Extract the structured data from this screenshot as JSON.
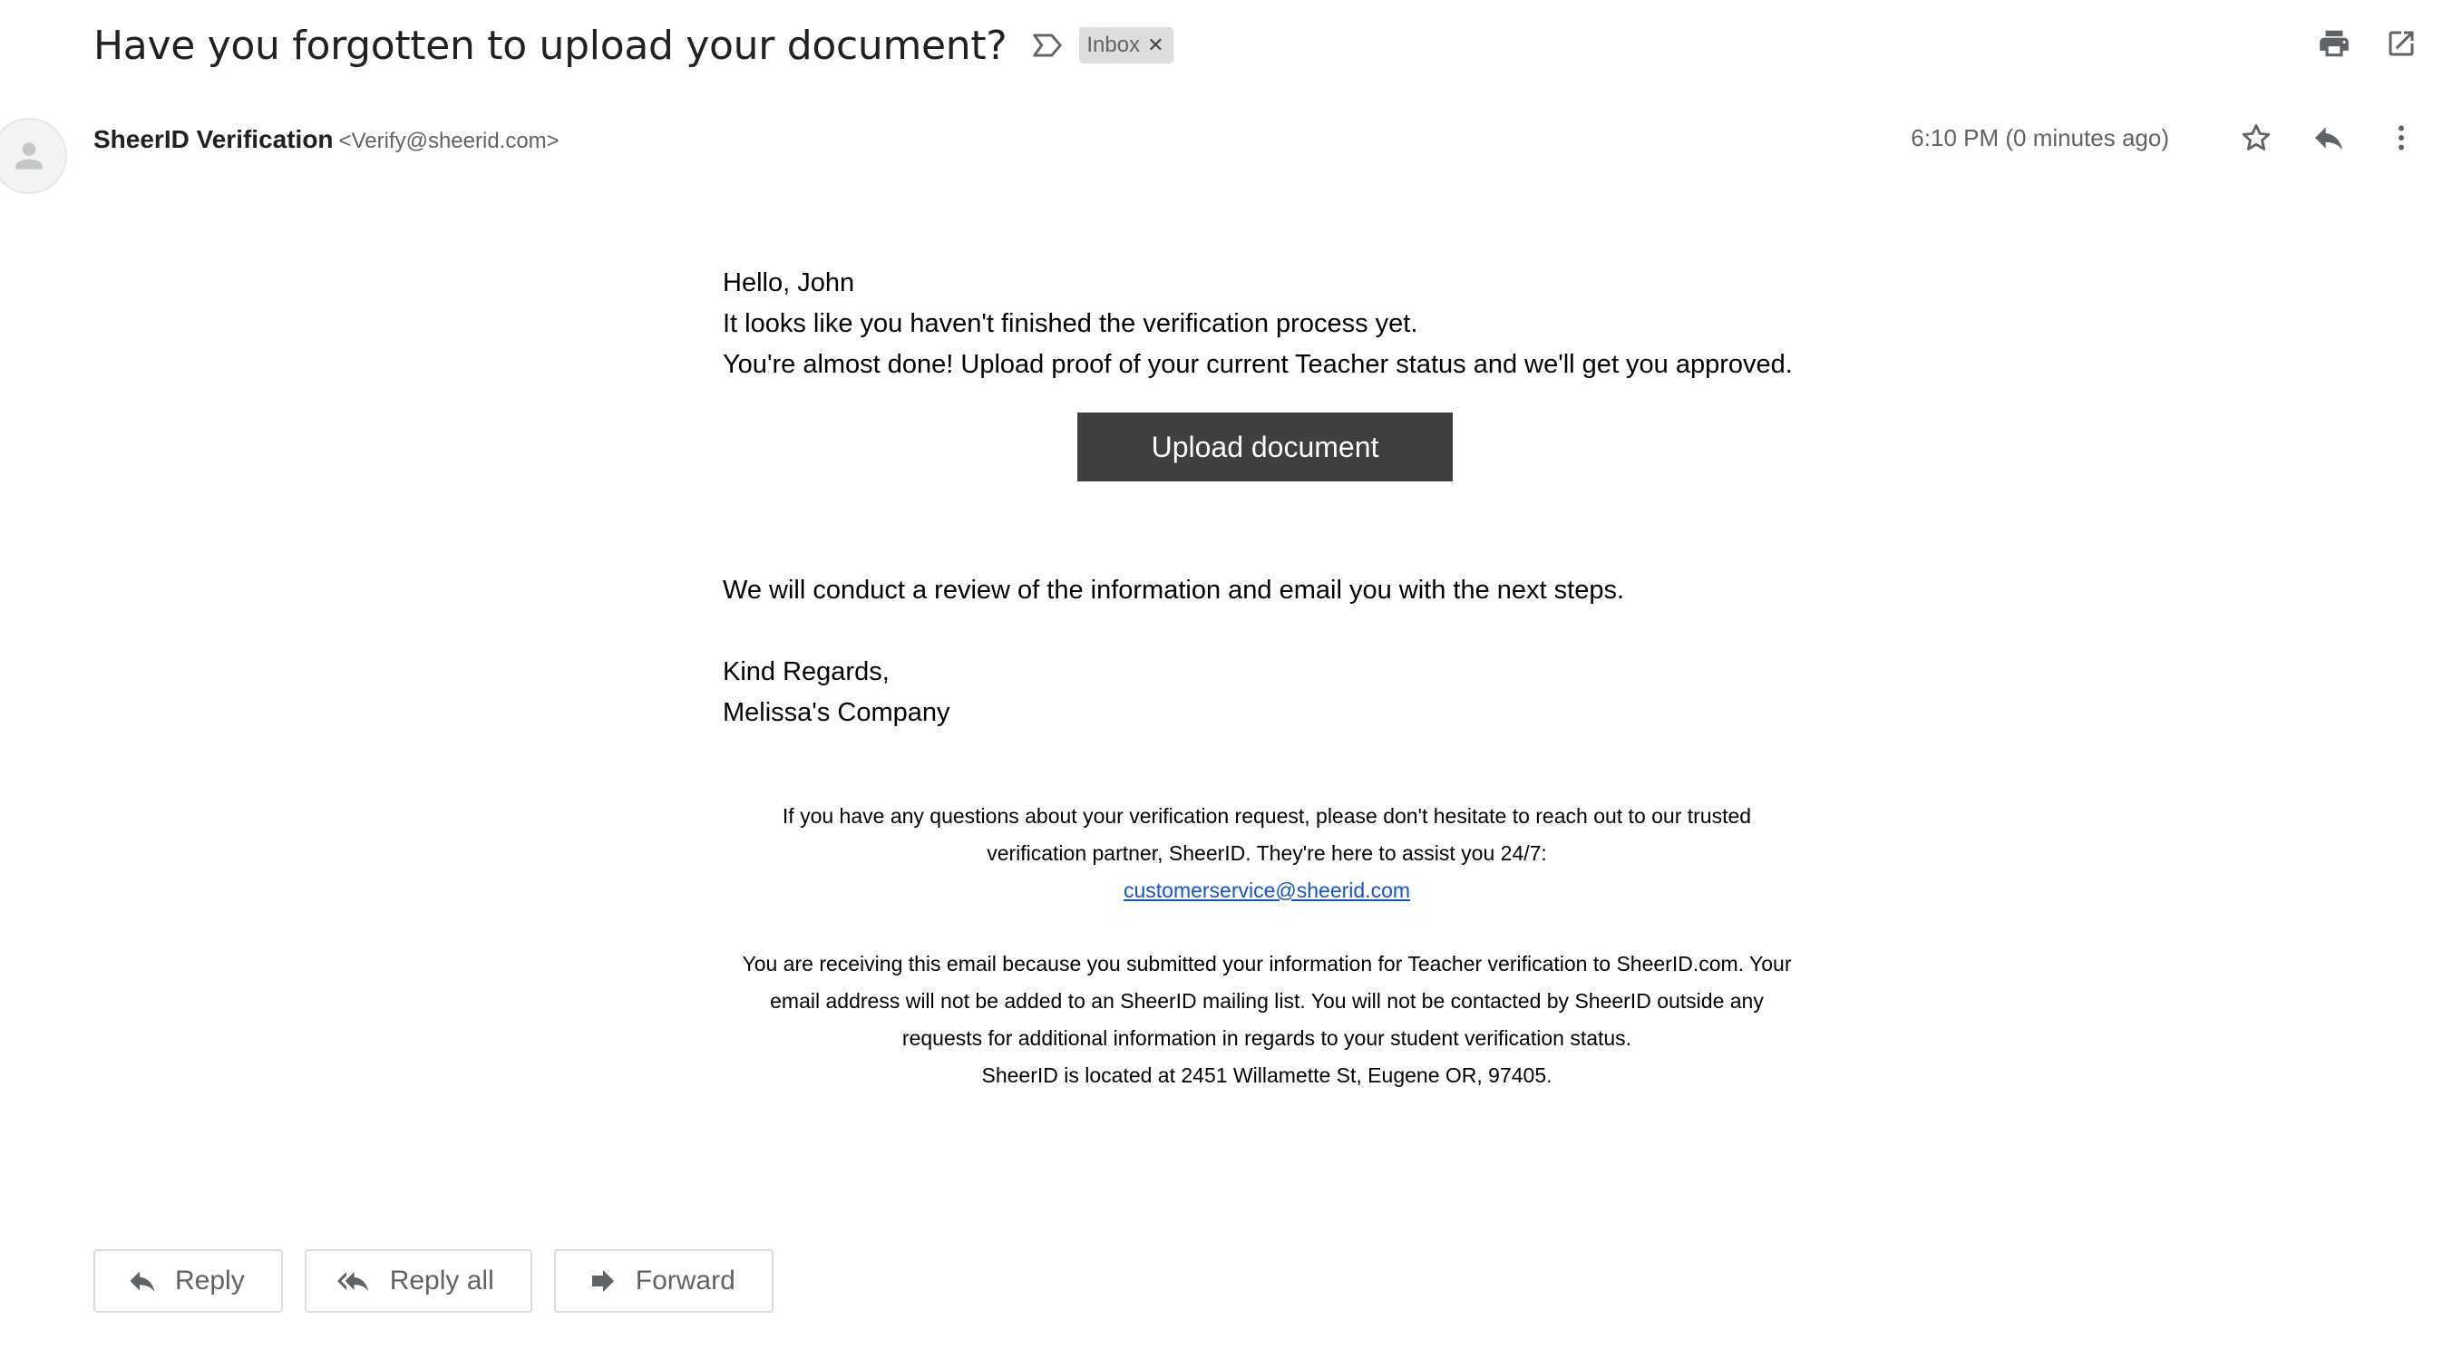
{
  "email": {
    "subject": "Have you forgotten to upload your document?",
    "label_chip": "Inbox",
    "sender_name": "SheerID Verification",
    "sender_email": "<Verify@sheerid.com>",
    "time": "6:10 PM (0 minutes ago)"
  },
  "body": {
    "greeting": "Hello, John",
    "line1": "It looks like you haven't finished the verification process yet.",
    "line2": "You're almost done! Upload proof of your current Teacher status and we'll get you approved.",
    "cta": "Upload document",
    "line3": "We will conduct a review of the information and email you with the next steps.",
    "closing": "Kind Regards,",
    "signature": "Melissa's Company"
  },
  "footer": {
    "questions_1": "If you have any questions about your verification request, please don't hesitate to reach out to our trusted",
    "questions_2": "verification partner, SheerID. They're here to assist you 24/7:",
    "support_email": "customerservice@sheerid.com",
    "notice_1": "You are receiving this email because you submitted your information for Teacher verification to SheerID.com. Your",
    "notice_2": "email address will not be added to an SheerID mailing list. You will not be contacted by SheerID outside any",
    "notice_3": "requests for additional information in regards to your student verification status.",
    "address": "SheerID is located at 2451 Willamette St, Eugene OR, 97405."
  },
  "actions": {
    "reply": "Reply",
    "reply_all": "Reply all",
    "forward": "Forward"
  },
  "icons": {
    "label": "label-outline-icon",
    "print": "print-icon",
    "open_new": "open-in-new-icon",
    "star": "star-outline-icon",
    "reply": "reply-icon",
    "more": "more-vert-icon"
  },
  "colors": {
    "cta_bg": "#3f3f3f",
    "link": "#1155cc",
    "chip_bg": "#dddddd",
    "muted": "#5f6368"
  }
}
